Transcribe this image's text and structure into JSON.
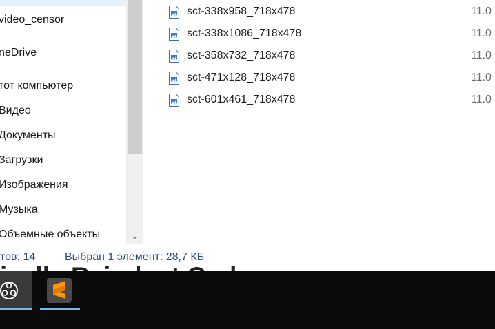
{
  "navigation": {
    "items": [
      {
        "label": "video_censor",
        "icon": "folder-icon"
      },
      {
        "label": "neDrive",
        "icon": "onedrive-icon"
      },
      {
        "label": "тот компьютер",
        "icon": "this-pc-icon"
      },
      {
        "label": "Видео",
        "icon": "video-folder-icon"
      },
      {
        "label": "Документы",
        "icon": "documents-folder-icon"
      },
      {
        "label": "Загрузки",
        "icon": "downloads-folder-icon"
      },
      {
        "label": "Изображения",
        "icon": "pictures-folder-icon"
      },
      {
        "label": "Музыка",
        "icon": "music-folder-icon"
      },
      {
        "label": "Объемные объекты",
        "icon": "3d-objects-folder-icon"
      }
    ],
    "scroll_down_glyph": "⌄"
  },
  "files": [
    {
      "name": "sct-338x958_718x478",
      "date": "11.0"
    },
    {
      "name": "sct-338x1086_718x478",
      "date": "11.0"
    },
    {
      "name": "sct-358x732_718x478",
      "date": "11.0"
    },
    {
      "name": "sct-471x128_718x478",
      "date": "11.0"
    },
    {
      "name": "sct-601x461_718x478",
      "date": "11.0"
    }
  ],
  "status_bar": {
    "count": "тов: 14",
    "selection": "Выбран 1 элемент: 28,7 КБ"
  },
  "background_heading": "ically Reindent Code",
  "taskbar": {
    "apps": [
      {
        "name": "OBS Studio",
        "icon": "obs-icon"
      },
      {
        "name": "Sublime Text",
        "icon": "sublime-text-icon"
      }
    ]
  },
  "colors": {
    "accent": "#76b9ed",
    "status_text": "#2b4a77",
    "taskbar": "#0b0b0b",
    "sublime_orange": "#ff9800"
  }
}
